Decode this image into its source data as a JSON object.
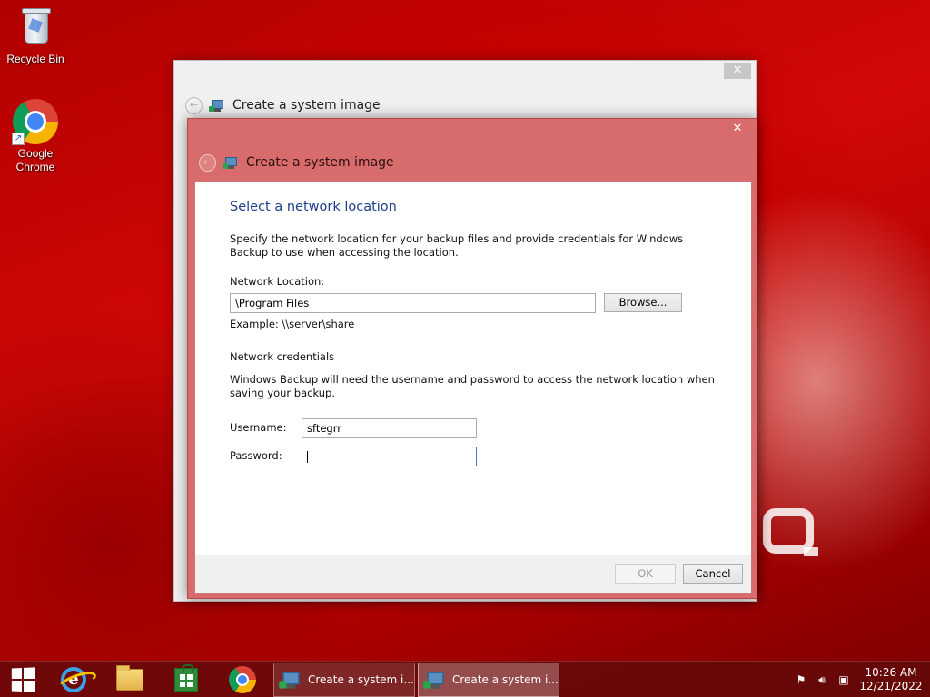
{
  "desktop": {
    "icons": [
      {
        "label": "Recycle Bin"
      },
      {
        "label": "Google Chrome"
      }
    ]
  },
  "back_window": {
    "title": "Create a system image",
    "close_glyph": "✕"
  },
  "dialog": {
    "title": "Create a system image",
    "close_glyph": "✕",
    "heading": "Select a network location",
    "description": "Specify the network location for your backup files and provide credentials for Windows Backup to use when accessing the location.",
    "network_location_label": "Network Location:",
    "network_location_value": "\\Program Files",
    "browse_label": "Browse...",
    "example_text": "Example: \\\\server\\share",
    "credentials_heading": "Network credentials",
    "credentials_description": "Windows Backup will need the username and password to access the network location when saving your backup.",
    "username_label": "Username:",
    "username_value": "sftegrr",
    "password_label": "Password:",
    "password_value": "",
    "ok_label": "OK",
    "cancel_label": "Cancel"
  },
  "taskbar": {
    "pinned": [
      {
        "icon": "windows-start-icon"
      },
      {
        "icon": "internet-explorer-icon"
      },
      {
        "icon": "file-explorer-icon"
      },
      {
        "icon": "store-icon"
      },
      {
        "icon": "chrome-icon"
      }
    ],
    "tasks": [
      {
        "label": "Create a system i..."
      },
      {
        "label": "Create a system i..."
      }
    ],
    "tray": {
      "time": "10:26 AM",
      "date": "12/21/2022"
    }
  },
  "colors": {
    "dialog_frame": "#d86b6b",
    "heading": "#1e3f8a",
    "desktop": "#c30000"
  }
}
